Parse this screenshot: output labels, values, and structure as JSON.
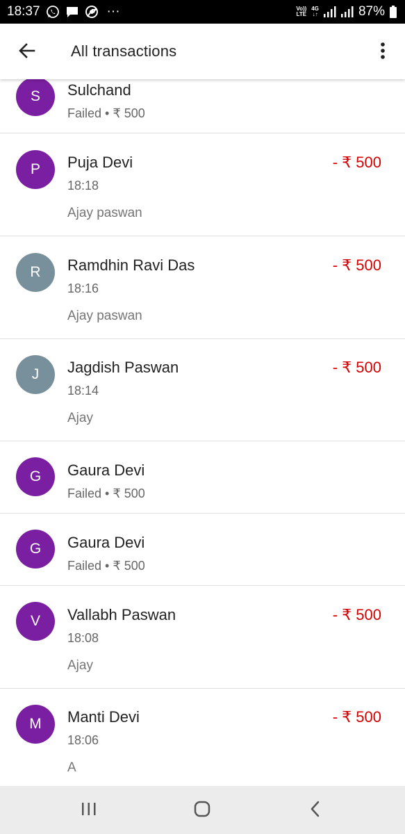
{
  "status_bar": {
    "time": "18:37",
    "volte_top": "Vo))",
    "volte_bottom": "LTE",
    "network_top": "4G",
    "network_bottom": "↓↑",
    "battery": "87%",
    "overflow": "···"
  },
  "app_bar": {
    "title": "All transactions"
  },
  "transactions": [
    {
      "initial": "S",
      "name": "Sulchand",
      "sub": "Failed • ₹ 500",
      "note": "",
      "amount": "",
      "color": "#7b1fa2"
    },
    {
      "initial": "P",
      "name": "Puja Devi",
      "sub": "18:18",
      "note": "Ajay paswan",
      "amount": "- ₹ 500",
      "color": "#7b1fa2"
    },
    {
      "initial": "R",
      "name": "Ramdhin Ravi Das",
      "sub": "18:16",
      "note": "Ajay paswan",
      "amount": "- ₹ 500",
      "color": "#78909c"
    },
    {
      "initial": "J",
      "name": "Jagdish Paswan",
      "sub": "18:14",
      "note": "Ajay",
      "amount": "- ₹ 500",
      "color": "#78909c"
    },
    {
      "initial": "G",
      "name": "Gaura Devi",
      "sub": "Failed • ₹ 500",
      "note": "",
      "amount": "",
      "color": "#7b1fa2"
    },
    {
      "initial": "G",
      "name": "Gaura Devi",
      "sub": "Failed • ₹ 500",
      "note": "",
      "amount": "",
      "color": "#7b1fa2"
    },
    {
      "initial": "V",
      "name": "Vallabh Paswan",
      "sub": "18:08",
      "note": "Ajay",
      "amount": "- ₹ 500",
      "color": "#7b1fa2"
    },
    {
      "initial": "M",
      "name": "Manti Devi",
      "sub": "18:06",
      "note": "A",
      "amount": "- ₹ 500",
      "color": "#7b1fa2"
    }
  ],
  "icons": {
    "back": "arrow-back-icon",
    "more": "more-vert-icon",
    "recents": "recents-icon",
    "home": "home-icon",
    "nav_back": "nav-back-icon"
  },
  "colors": {
    "amount_debit": "#d50000",
    "avatar_purple": "#7b1fa2",
    "avatar_grey": "#78909c"
  }
}
